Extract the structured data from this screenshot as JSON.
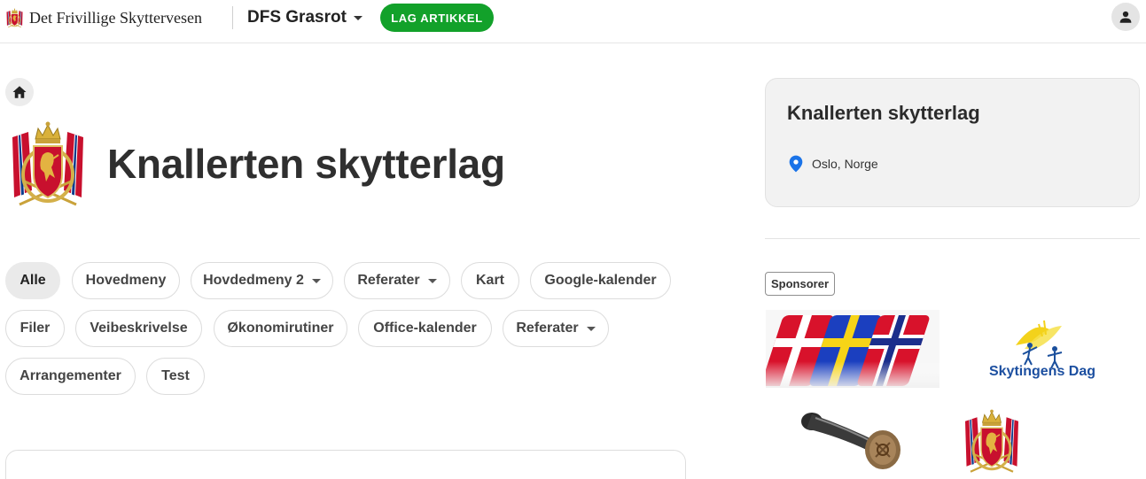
{
  "topbar": {
    "brand_name": "Det Frivillige Skyttervesen",
    "site_name": "DFS Grasrot",
    "new_article_label": "LAG ARTIKKEL"
  },
  "page": {
    "title": "Knallerten skytterlag"
  },
  "filters": [
    {
      "label": "Alle",
      "active": true,
      "dropdown": false
    },
    {
      "label": "Hovedmeny",
      "active": false,
      "dropdown": false
    },
    {
      "label": "Hovdedmeny 2",
      "active": false,
      "dropdown": true
    },
    {
      "label": "Referater",
      "active": false,
      "dropdown": true
    },
    {
      "label": "Kart",
      "active": false,
      "dropdown": false
    },
    {
      "label": "Google-kalender",
      "active": false,
      "dropdown": false
    },
    {
      "label": "Filer",
      "active": false,
      "dropdown": false
    },
    {
      "label": "Veibeskrivelse",
      "active": false,
      "dropdown": false
    },
    {
      "label": "Økonomirutiner",
      "active": false,
      "dropdown": false
    },
    {
      "label": "Office-kalender",
      "active": false,
      "dropdown": false
    },
    {
      "label": "Referater",
      "active": false,
      "dropdown": true
    },
    {
      "label": "Arrangementer",
      "active": false,
      "dropdown": false
    },
    {
      "label": "Test",
      "active": false,
      "dropdown": false
    }
  ],
  "sidebar": {
    "card_title": "Knallerten skytterlag",
    "location": "Oslo, Norge",
    "sponsors_label": "Sponsorer",
    "sponsors": [
      {
        "name": "nordic-flags-logo"
      },
      {
        "name": "Skytingens Dag"
      },
      {
        "name": "shooting-trophy-logo"
      },
      {
        "name": "dfs-coat-of-arms-logo"
      }
    ]
  },
  "colors": {
    "accent_green": "#12a12a",
    "location_pin_blue": "#1a73e8",
    "chip_active_bg": "#eaeaea"
  },
  "icons": [
    "home-icon",
    "user-icon",
    "location-pin-icon",
    "chevron-down-icon"
  ]
}
